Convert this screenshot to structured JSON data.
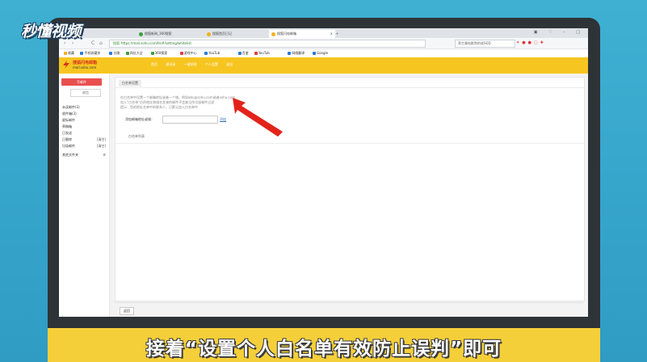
{
  "watermark": {
    "logo": "秒懂视频"
  },
  "browser": {
    "tabs": [
      {
        "label": "客户世界",
        "color": "#2b7bd8"
      },
      {
        "label": "搜狐新闻_360搜索",
        "color": "#3aa23a"
      },
      {
        "label": "搜狐首页日记",
        "color": "#f3b01d"
      },
      {
        "label": "搜狐闪电邮箱",
        "color": "#f3b01d",
        "active": true
      }
    ],
    "tab_close": "×",
    "new_tab": "+",
    "window_controls": "▣ ♡ – □",
    "back": "‹",
    "forward": "›",
    "reload": "C",
    "home": "⌂",
    "url": "https://mail.sohu.com/fe/#/setting/whitelist",
    "url_prefix": "搜狐",
    "search_placeholder": "养生康电影院的戒SDD",
    "bookmarks": [
      {
        "label": "收藏",
        "color": "#f3b01d"
      },
      {
        "label": "手机收藏夹",
        "color": "#2b7bd8"
      },
      {
        "label": "谷歌",
        "color": "#2b7bd8"
      },
      {
        "label": "网址大全",
        "color": "#3aa23a"
      },
      {
        "label": "360搜索",
        "color": "#3aa23a"
      },
      {
        "label": "游戏中心",
        "color": "#e23b3b"
      },
      {
        "label": "YouTub",
        "color": "#2b7bd8"
      },
      {
        "label": "百度",
        "color": "#2b7bd8"
      },
      {
        "label": "YouTub",
        "color": "#e23b3b"
      },
      {
        "label": "网络翻译",
        "color": "#2b7bd8"
      },
      {
        "label": "Google",
        "color": "#2b7bd8"
      }
    ]
  },
  "mail": {
    "brand_title": "搜狐闪电邮箱",
    "brand_subtitle": "mail.sohu.com",
    "topnav": [
      "首页",
      "通讯录",
      "一键求助",
      "个人设置",
      "退出"
    ],
    "compose": "写邮件",
    "receive": "收信",
    "folders": [
      {
        "label": "未读邮件(3)",
        "action": ""
      },
      {
        "label": "收件箱(3)",
        "action": ""
      },
      {
        "label": "星标邮件",
        "action": ""
      },
      {
        "label": "草稿箱",
        "action": ""
      },
      {
        "label": "已发送",
        "action": ""
      },
      {
        "label": "已删除",
        "action": "[清空]"
      },
      {
        "label": "垃圾邮件",
        "action": "[清空]"
      }
    ],
    "other_folders": "其他文件夹",
    "other_folders_icon": "⚙",
    "panel_title": "白名单设置",
    "desc": [
      "在白名单中设置一个邮箱地址或者一个域，例如abc@sohu.com或者sohu.com",
      "加入“白名单”后的地址和域名发来的邮件不会被当作垃圾邮件过滤",
      "提示：您的地址名单中的联系人，已默认加入白名单中"
    ],
    "add_label": "添加邮箱地址或域：",
    "add_button": "添加",
    "list_caption": "白名单列表",
    "back_button": "返回"
  },
  "caption": "接着“设置个人白名单有效防止误判”即可"
}
